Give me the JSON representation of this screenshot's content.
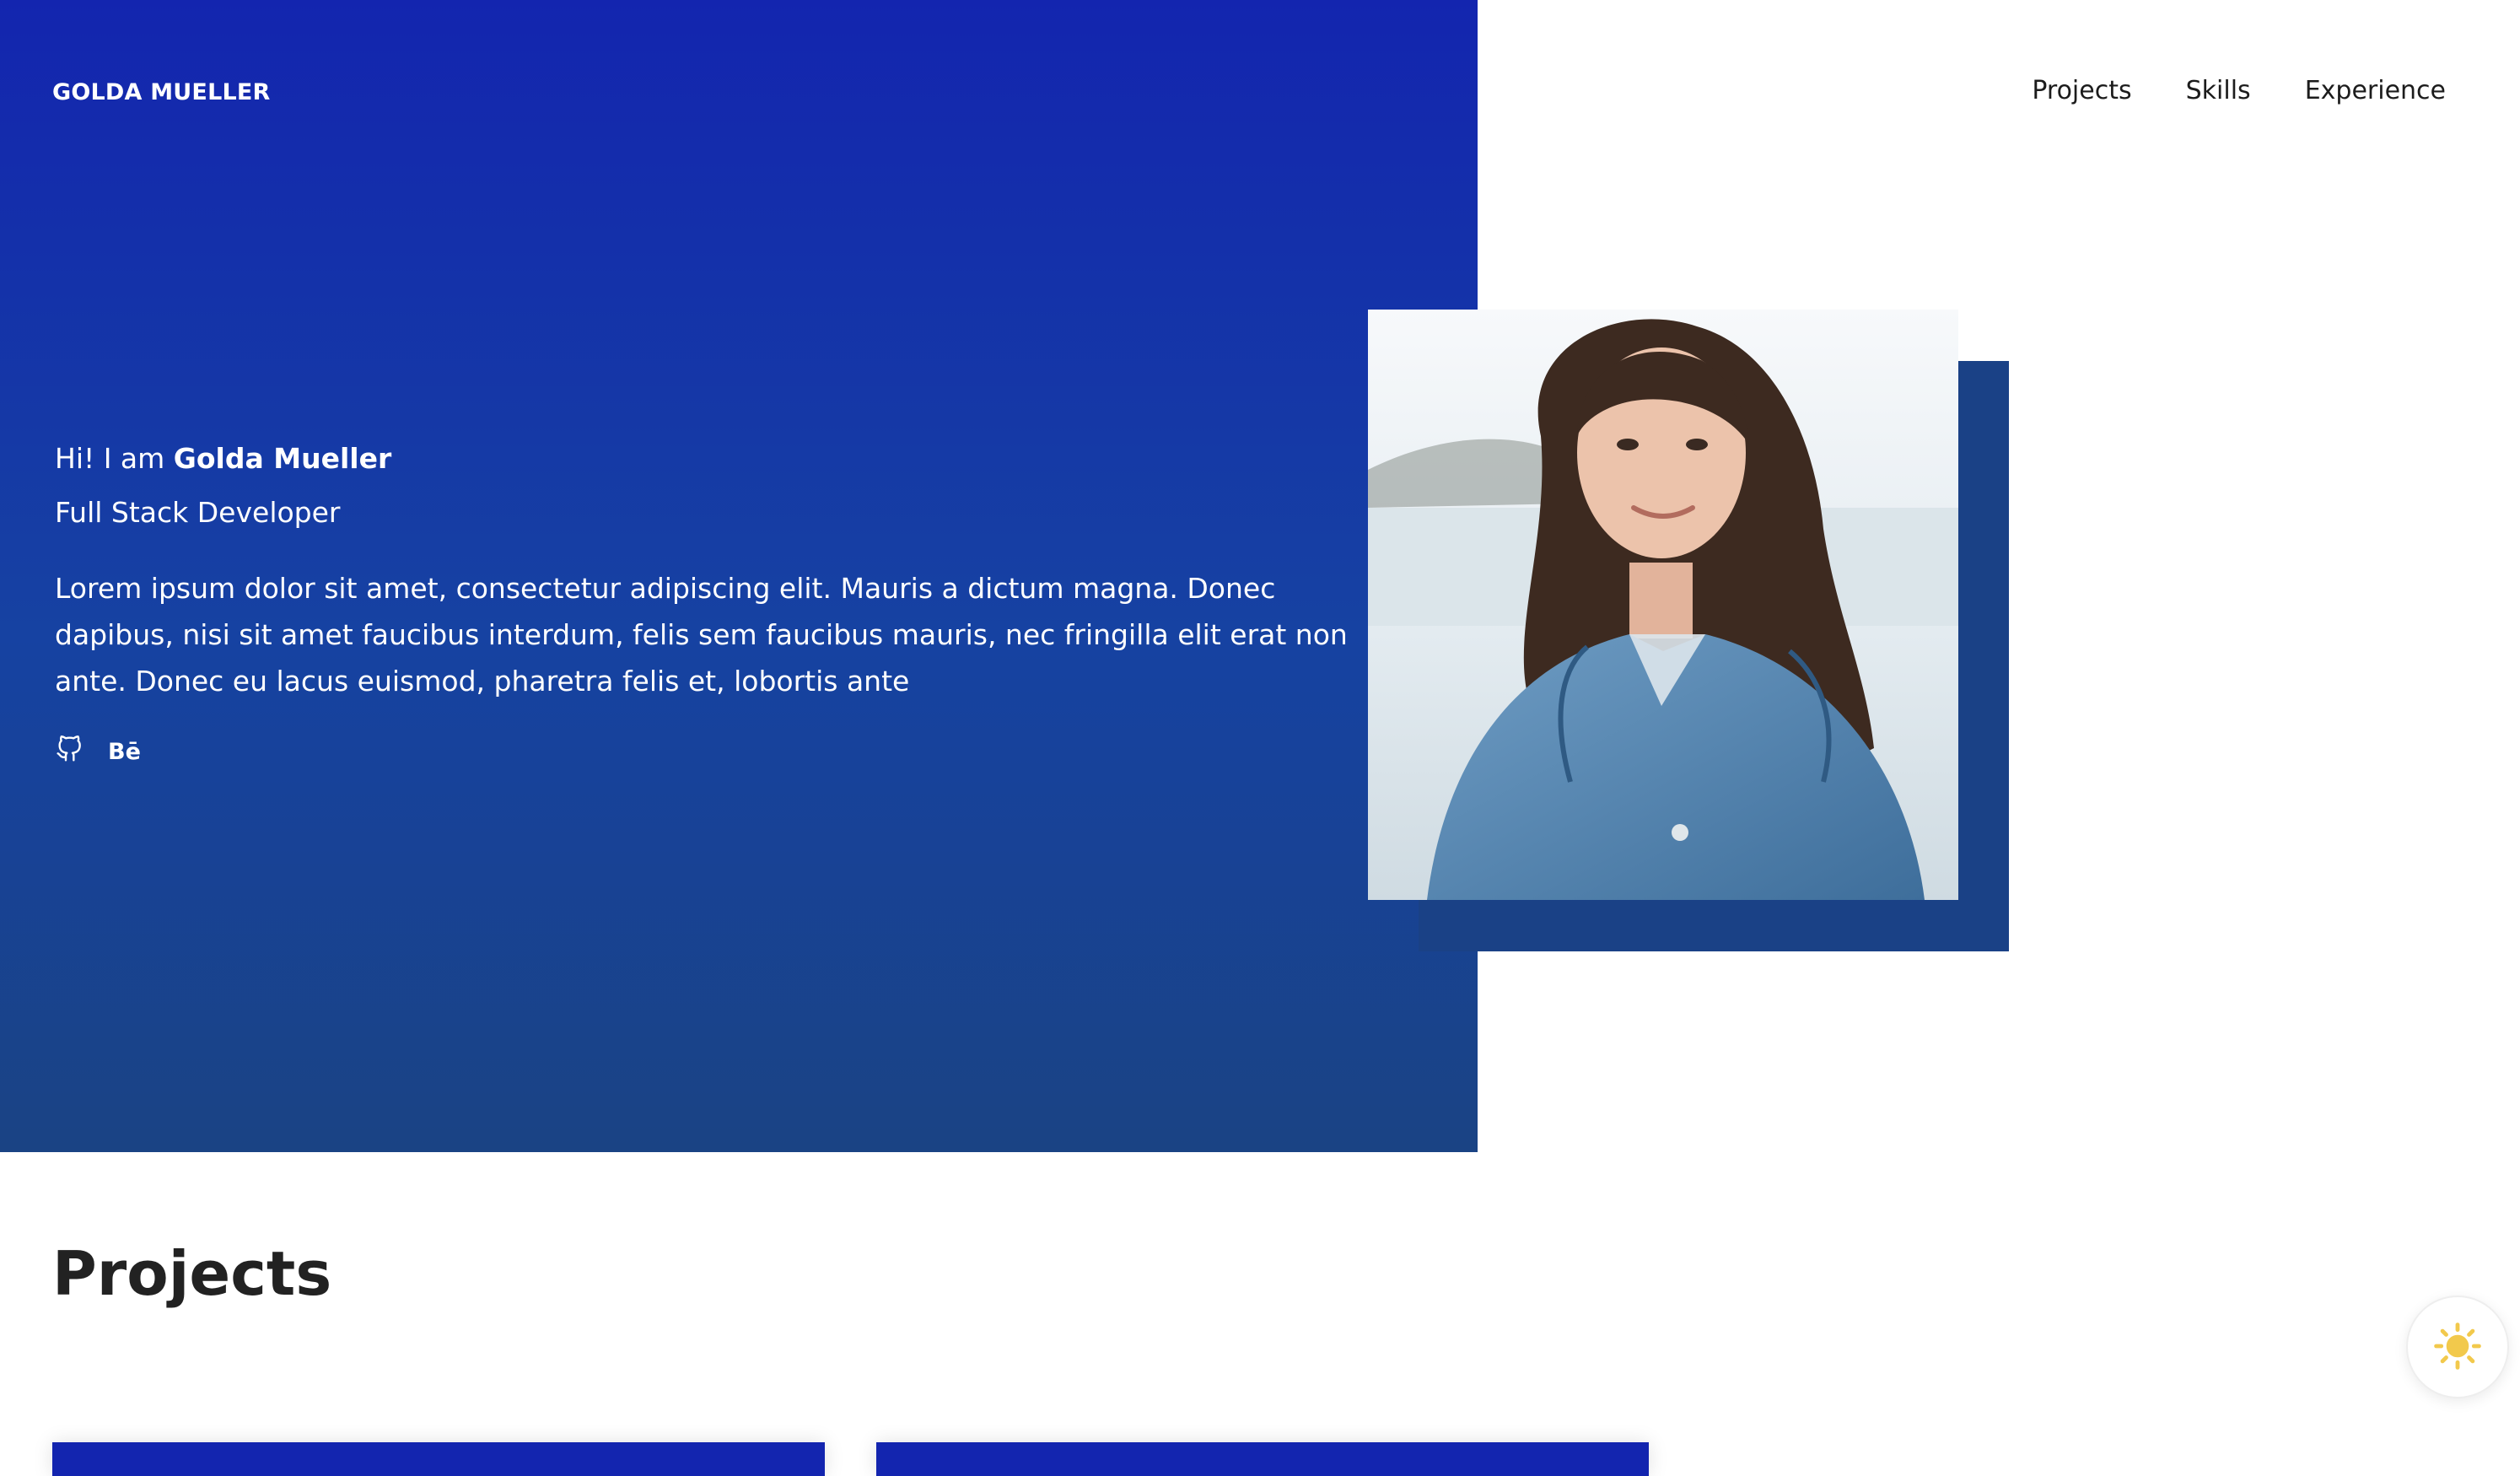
{
  "header": {
    "logo": "GOLDA MUELLER",
    "nav": [
      {
        "label": "Projects"
      },
      {
        "label": "Skills"
      },
      {
        "label": "Experience"
      }
    ]
  },
  "hero": {
    "greeting": "Hi! I am ",
    "name": "Golda Mueller",
    "role": "Full Stack Developer",
    "bio": "Lorem ipsum dolor sit amet, consectetur adipiscing elit. Mauris a dictum magna. Donec dapibus, nisi sit amet faucibus interdum, felis sem faucibus mauris, nec fringilla elit erat non ante. Donec eu lacus euismod, pharetra felis et, lobortis ante",
    "socials": [
      {
        "icon": "github-icon"
      },
      {
        "icon": "behance-icon",
        "label": "Bē"
      }
    ]
  },
  "projects": {
    "title": "Projects"
  },
  "theme_toggle": {
    "icon": "sun-icon"
  },
  "colors": {
    "hero_gradient_top": "#1325AF",
    "hero_gradient_bottom": "#1A4384",
    "photo_frame": "#1A4186",
    "sun": "#F2C94C",
    "text_dark": "#222222"
  }
}
